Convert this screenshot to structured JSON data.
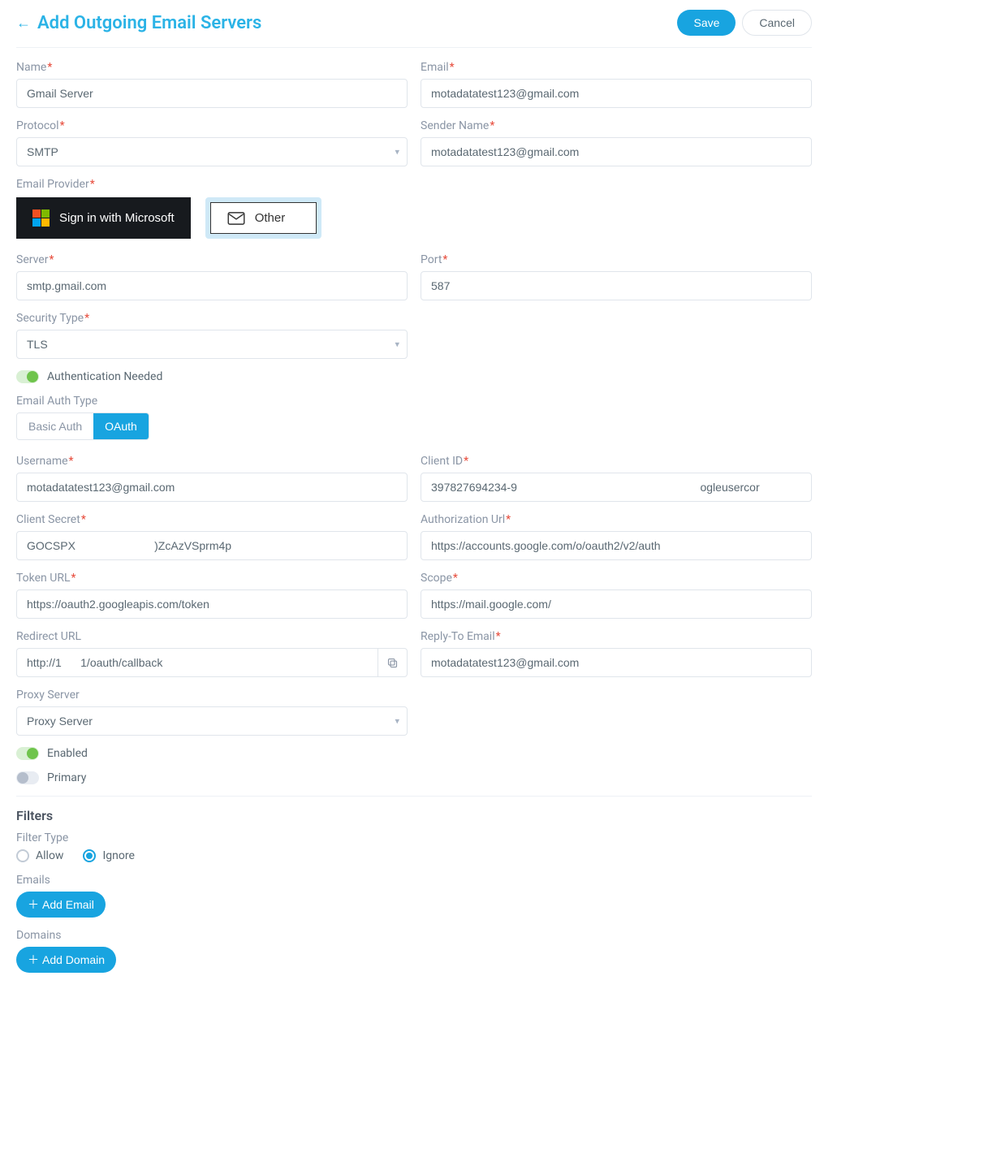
{
  "header": {
    "title": "Add Outgoing Email Servers",
    "save_label": "Save",
    "cancel_label": "Cancel"
  },
  "labels": {
    "name": "Name",
    "email": "Email",
    "protocol": "Protocol",
    "sender_name": "Sender Name",
    "email_provider": "Email Provider",
    "server": "Server",
    "port": "Port",
    "security_type": "Security Type",
    "auth_needed": "Authentication Needed",
    "email_auth_type": "Email Auth Type",
    "username": "Username",
    "client_id": "Client ID",
    "client_secret": "Client Secret",
    "authorization_url": "Authorization Url",
    "token_url": "Token URL",
    "scope": "Scope",
    "redirect_url": "Redirect URL",
    "reply_to_email": "Reply-To Email",
    "proxy_server": "Proxy Server",
    "enabled": "Enabled",
    "primary": "Primary",
    "filters": "Filters",
    "filter_type": "Filter Type",
    "allow": "Allow",
    "ignore": "Ignore",
    "emails": "Emails",
    "add_email": "Add Email",
    "domains": "Domains",
    "add_domain": "Add Domain"
  },
  "provider": {
    "ms_label": "Sign in with Microsoft",
    "other_label": "Other"
  },
  "auth_type": {
    "basic": "Basic Auth",
    "oauth": "OAuth"
  },
  "values": {
    "name": "Gmail Server",
    "email": "motadatatest123@gmail.com",
    "protocol": "SMTP",
    "sender_name": "motadatatest123@gmail.com",
    "server": "smtp.gmail.com",
    "port": "587",
    "security_type": "TLS",
    "username": "motadatatest123@gmail.com",
    "client_id": "397827694234-9                                                          ogleusercor",
    "client_secret": "GOCSPX                         )ZcAzVSprm4p",
    "authorization_url": "https://accounts.google.com/o/oauth2/v2/auth",
    "token_url": "https://oauth2.googleapis.com/token",
    "scope": "https://mail.google.com/",
    "redirect_url": "http://1      1/oauth/callback",
    "reply_to_email": "motadatatest123@gmail.com",
    "proxy_server": "Proxy Server"
  },
  "toggles": {
    "auth_needed": true,
    "enabled": true,
    "primary": false
  },
  "filter_type_selected": "ignore"
}
